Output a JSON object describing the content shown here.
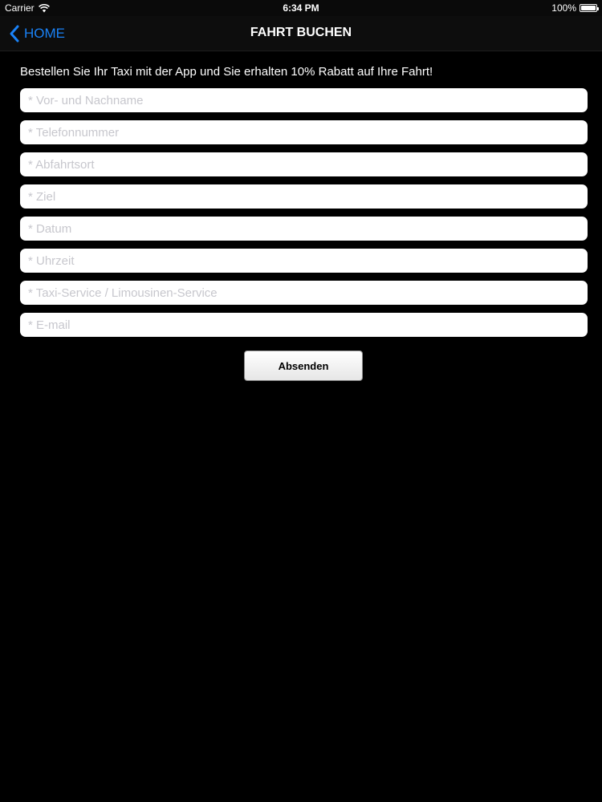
{
  "status_bar": {
    "carrier": "Carrier",
    "wifi_icon": "wifi-icon",
    "time": "6:34 PM",
    "battery_text": "100%",
    "battery_level": 1.0
  },
  "nav": {
    "back_label": "HOME",
    "back_icon": "chevron-left-icon",
    "title": "FAHRT BUCHEN",
    "accent_color": "#1a82f7"
  },
  "form": {
    "intro": "Bestellen Sie Ihr Taxi mit der App und Sie erhalten 10% Rabatt auf Ihre Fahrt!",
    "fields": [
      {
        "placeholder": "* Vor- und Nachname",
        "value": ""
      },
      {
        "placeholder": "* Telefonnummer",
        "value": ""
      },
      {
        "placeholder": "* Abfahrtsort",
        "value": ""
      },
      {
        "placeholder": "* Ziel",
        "value": ""
      },
      {
        "placeholder": "* Datum",
        "value": ""
      },
      {
        "placeholder": "* Uhrzeit",
        "value": ""
      },
      {
        "placeholder": "* Taxi-Service / Limousinen-Service",
        "value": ""
      },
      {
        "placeholder": "* E-mail",
        "value": ""
      }
    ],
    "submit_label": "Absenden"
  }
}
